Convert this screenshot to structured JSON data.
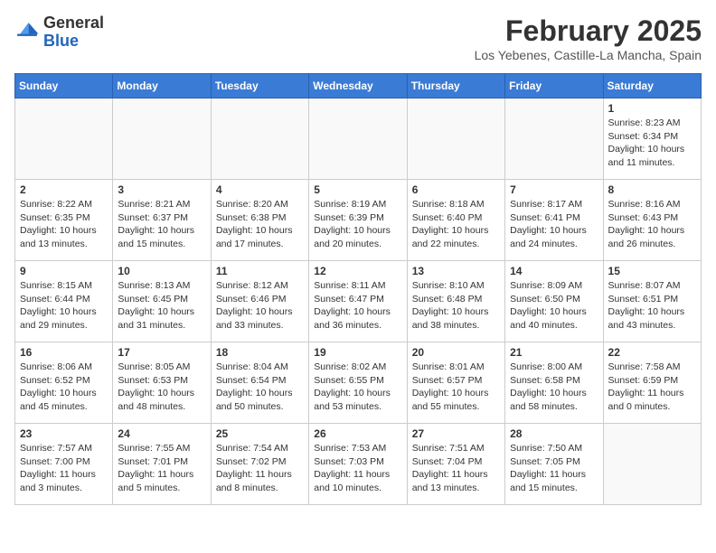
{
  "header": {
    "logo_general": "General",
    "logo_blue": "Blue",
    "month_year": "February 2025",
    "location": "Los Yebenes, Castille-La Mancha, Spain"
  },
  "weekdays": [
    "Sunday",
    "Monday",
    "Tuesday",
    "Wednesday",
    "Thursday",
    "Friday",
    "Saturday"
  ],
  "weeks": [
    [
      {
        "day": "",
        "info": ""
      },
      {
        "day": "",
        "info": ""
      },
      {
        "day": "",
        "info": ""
      },
      {
        "day": "",
        "info": ""
      },
      {
        "day": "",
        "info": ""
      },
      {
        "day": "",
        "info": ""
      },
      {
        "day": "1",
        "info": "Sunrise: 8:23 AM\nSunset: 6:34 PM\nDaylight: 10 hours and 11 minutes."
      }
    ],
    [
      {
        "day": "2",
        "info": "Sunrise: 8:22 AM\nSunset: 6:35 PM\nDaylight: 10 hours and 13 minutes."
      },
      {
        "day": "3",
        "info": "Sunrise: 8:21 AM\nSunset: 6:37 PM\nDaylight: 10 hours and 15 minutes."
      },
      {
        "day": "4",
        "info": "Sunrise: 8:20 AM\nSunset: 6:38 PM\nDaylight: 10 hours and 17 minutes."
      },
      {
        "day": "5",
        "info": "Sunrise: 8:19 AM\nSunset: 6:39 PM\nDaylight: 10 hours and 20 minutes."
      },
      {
        "day": "6",
        "info": "Sunrise: 8:18 AM\nSunset: 6:40 PM\nDaylight: 10 hours and 22 minutes."
      },
      {
        "day": "7",
        "info": "Sunrise: 8:17 AM\nSunset: 6:41 PM\nDaylight: 10 hours and 24 minutes."
      },
      {
        "day": "8",
        "info": "Sunrise: 8:16 AM\nSunset: 6:43 PM\nDaylight: 10 hours and 26 minutes."
      }
    ],
    [
      {
        "day": "9",
        "info": "Sunrise: 8:15 AM\nSunset: 6:44 PM\nDaylight: 10 hours and 29 minutes."
      },
      {
        "day": "10",
        "info": "Sunrise: 8:13 AM\nSunset: 6:45 PM\nDaylight: 10 hours and 31 minutes."
      },
      {
        "day": "11",
        "info": "Sunrise: 8:12 AM\nSunset: 6:46 PM\nDaylight: 10 hours and 33 minutes."
      },
      {
        "day": "12",
        "info": "Sunrise: 8:11 AM\nSunset: 6:47 PM\nDaylight: 10 hours and 36 minutes."
      },
      {
        "day": "13",
        "info": "Sunrise: 8:10 AM\nSunset: 6:48 PM\nDaylight: 10 hours and 38 minutes."
      },
      {
        "day": "14",
        "info": "Sunrise: 8:09 AM\nSunset: 6:50 PM\nDaylight: 10 hours and 40 minutes."
      },
      {
        "day": "15",
        "info": "Sunrise: 8:07 AM\nSunset: 6:51 PM\nDaylight: 10 hours and 43 minutes."
      }
    ],
    [
      {
        "day": "16",
        "info": "Sunrise: 8:06 AM\nSunset: 6:52 PM\nDaylight: 10 hours and 45 minutes."
      },
      {
        "day": "17",
        "info": "Sunrise: 8:05 AM\nSunset: 6:53 PM\nDaylight: 10 hours and 48 minutes."
      },
      {
        "day": "18",
        "info": "Sunrise: 8:04 AM\nSunset: 6:54 PM\nDaylight: 10 hours and 50 minutes."
      },
      {
        "day": "19",
        "info": "Sunrise: 8:02 AM\nSunset: 6:55 PM\nDaylight: 10 hours and 53 minutes."
      },
      {
        "day": "20",
        "info": "Sunrise: 8:01 AM\nSunset: 6:57 PM\nDaylight: 10 hours and 55 minutes."
      },
      {
        "day": "21",
        "info": "Sunrise: 8:00 AM\nSunset: 6:58 PM\nDaylight: 10 hours and 58 minutes."
      },
      {
        "day": "22",
        "info": "Sunrise: 7:58 AM\nSunset: 6:59 PM\nDaylight: 11 hours and 0 minutes."
      }
    ],
    [
      {
        "day": "23",
        "info": "Sunrise: 7:57 AM\nSunset: 7:00 PM\nDaylight: 11 hours and 3 minutes."
      },
      {
        "day": "24",
        "info": "Sunrise: 7:55 AM\nSunset: 7:01 PM\nDaylight: 11 hours and 5 minutes."
      },
      {
        "day": "25",
        "info": "Sunrise: 7:54 AM\nSunset: 7:02 PM\nDaylight: 11 hours and 8 minutes."
      },
      {
        "day": "26",
        "info": "Sunrise: 7:53 AM\nSunset: 7:03 PM\nDaylight: 11 hours and 10 minutes."
      },
      {
        "day": "27",
        "info": "Sunrise: 7:51 AM\nSunset: 7:04 PM\nDaylight: 11 hours and 13 minutes."
      },
      {
        "day": "28",
        "info": "Sunrise: 7:50 AM\nSunset: 7:05 PM\nDaylight: 11 hours and 15 minutes."
      },
      {
        "day": "",
        "info": ""
      }
    ]
  ]
}
